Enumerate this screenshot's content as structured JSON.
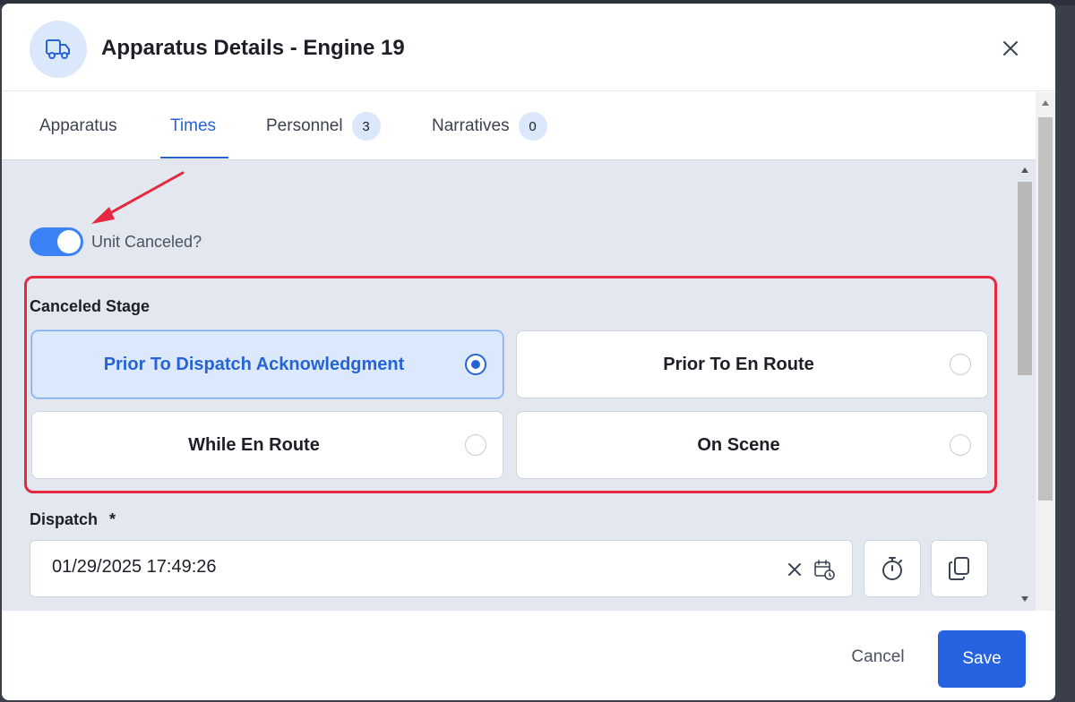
{
  "modal": {
    "title": "Apparatus Details - Engine 19",
    "header_icon": "truck-icon",
    "close_icon": "close-icon"
  },
  "tabs": [
    {
      "label": "Apparatus",
      "active": false
    },
    {
      "label": "Times",
      "active": true
    },
    {
      "label": "Personnel",
      "badge": "3",
      "active": false
    },
    {
      "label": "Narratives",
      "badge": "0",
      "active": false
    }
  ],
  "unit_canceled": {
    "label": "Unit Canceled?",
    "on": true
  },
  "canceled_stage": {
    "label": "Canceled Stage",
    "options": [
      {
        "label": "Prior To Dispatch Acknowledgment",
        "selected": true
      },
      {
        "label": "Prior To En Route",
        "selected": false
      },
      {
        "label": "While En Route",
        "selected": false
      },
      {
        "label": "On Scene",
        "selected": false
      }
    ]
  },
  "dispatch": {
    "label": "Dispatch",
    "required_mark": "*",
    "value": "01/29/2025 17:49:26",
    "clear_icon": "clear-icon",
    "calendar_icon": "calendar-clock-icon",
    "stopwatch_icon": "stopwatch-icon",
    "copy_icon": "copy-icon"
  },
  "footer": {
    "cancel_label": "Cancel",
    "save_label": "Save"
  },
  "colors": {
    "accent": "#2563d6",
    "annotation": "#e5293e",
    "content_bg": "#e3e8f0"
  }
}
